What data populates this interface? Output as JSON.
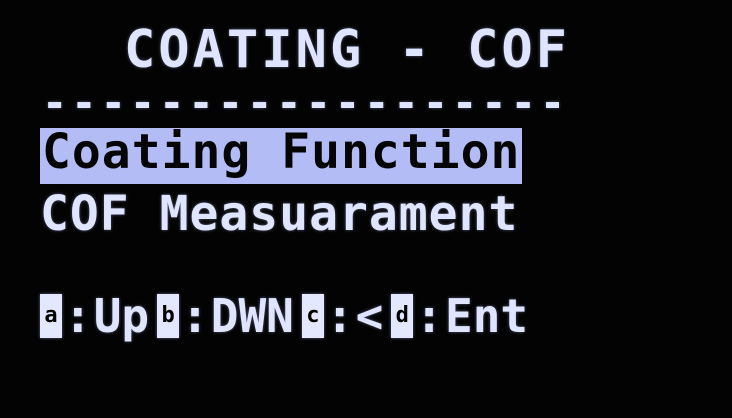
{
  "screen": {
    "title": "COATING - COF",
    "divider": "------------------"
  },
  "menu": {
    "items": [
      {
        "label": "Coating Function",
        "selected": true
      },
      {
        "label": "COF Measuarament",
        "selected": false
      }
    ]
  },
  "help": {
    "keys": [
      {
        "key": "a",
        "sep": ":",
        "action": "Up"
      },
      {
        "key": "b",
        "sep": ":",
        "action": "DWN"
      },
      {
        "key": "c",
        "sep": ":",
        "action": "<"
      },
      {
        "key": "d",
        "sep": ":",
        "action": "Ent"
      }
    ]
  },
  "colors": {
    "background": "#030303",
    "text": "#dfe4ff",
    "highlight": "#b4bcf6"
  }
}
